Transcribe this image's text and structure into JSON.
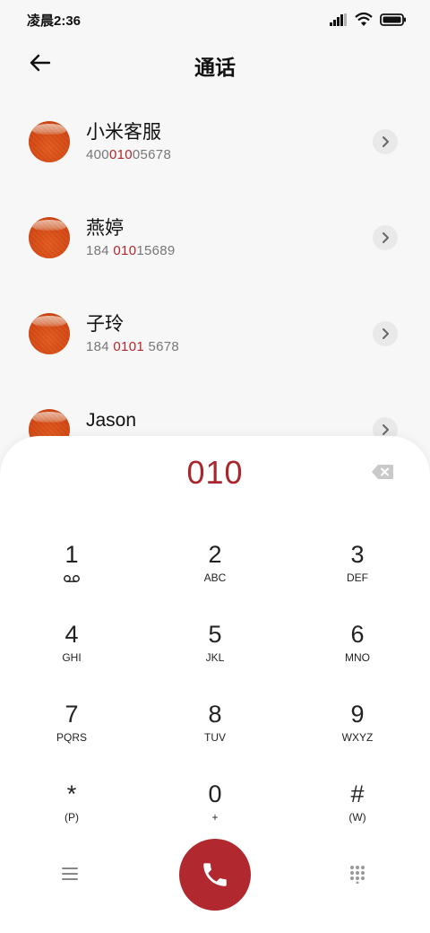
{
  "status_bar": {
    "time": "凌晨2:36",
    "icons": [
      "signal-icon",
      "wifi-icon",
      "battery-icon"
    ]
  },
  "header": {
    "title": "通话",
    "back_icon": "arrow-left-icon"
  },
  "contacts": [
    {
      "name": "小米客服",
      "number_pre": "400",
      "number_hl": "010",
      "number_post": "05678"
    },
    {
      "name": "燕婷",
      "number_pre": "184 ",
      "number_hl": "010",
      "number_post": "15689"
    },
    {
      "name": "子玲",
      "number_pre": "184 ",
      "number_hl": "0101",
      "number_post": " 5678"
    },
    {
      "name": "Jason",
      "number_pre": "",
      "number_hl": "",
      "number_post": ""
    }
  ],
  "dialpad": {
    "display": "010",
    "keys": [
      {
        "digit": "1",
        "sub": "",
        "sub_icon": "voicemail-icon"
      },
      {
        "digit": "2",
        "sub": "ABC"
      },
      {
        "digit": "3",
        "sub": "DEF"
      },
      {
        "digit": "4",
        "sub": "GHI"
      },
      {
        "digit": "5",
        "sub": "JKL"
      },
      {
        "digit": "6",
        "sub": "MNO"
      },
      {
        "digit": "7",
        "sub": "PQRS"
      },
      {
        "digit": "8",
        "sub": "TUV"
      },
      {
        "digit": "9",
        "sub": "WXYZ"
      },
      {
        "digit": "*",
        "sub": "(P)"
      },
      {
        "digit": "0",
        "sub": "+"
      },
      {
        "digit": "#",
        "sub": "(W)"
      }
    ]
  },
  "colors": {
    "accent": "#b1282e",
    "highlight_text": "#b0272d",
    "background": "#f7f7f7",
    "sheet": "#ffffff"
  }
}
